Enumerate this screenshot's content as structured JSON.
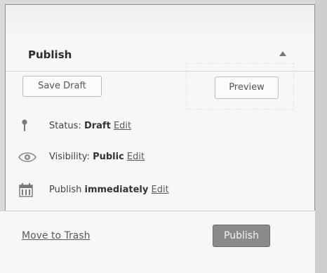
{
  "panel": {
    "title": "Publish",
    "toggle_icon": "triangle-up-icon"
  },
  "actions": {
    "save_draft_label": "Save Draft",
    "preview_label": "Preview"
  },
  "status": {
    "icon": "pin-icon",
    "label": "Status:",
    "value": "Draft",
    "edit_label": "Edit"
  },
  "visibility": {
    "icon": "eye-icon",
    "label": "Visibility:",
    "value": "Public",
    "edit_label": "Edit"
  },
  "schedule": {
    "icon": "calendar-icon",
    "label": "Publish",
    "value": "immediately",
    "edit_label": "Edit"
  },
  "footer": {
    "trash_label": "Move to Trash",
    "publish_label": "Publish"
  },
  "colors": {
    "panel_bg": "#f7f7f7",
    "primary_button": "#8a8a8a",
    "text": "#444444"
  }
}
